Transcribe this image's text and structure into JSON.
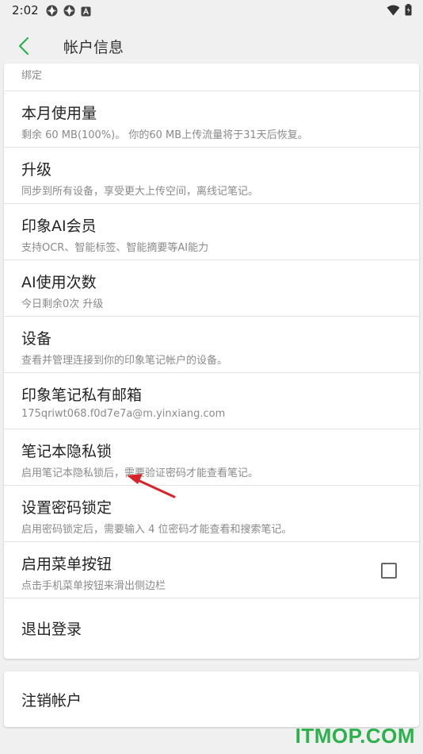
{
  "status_bar": {
    "time": "2:02"
  },
  "app_bar": {
    "title": "帐户信息",
    "back_icon": "chevron-left-icon"
  },
  "partial_row": {
    "subtitle": "绑定"
  },
  "rows": [
    {
      "title": "本月使用量",
      "subtitle": "剩余 60 MB(100%)。 你的60 MB上传流量将于31天后恢复。"
    },
    {
      "title": "升级",
      "subtitle": "同步到所有设备，享受更大上传空间，离线记笔记。"
    },
    {
      "title": "印象AI会员",
      "subtitle": "支持OCR、智能标签、智能摘要等AI能力"
    },
    {
      "title": "AI使用次数",
      "subtitle": "今日剩余0次 升级"
    },
    {
      "title": "设备",
      "subtitle": "查看并管理连接到你的印象笔记帐户的设备。"
    },
    {
      "title": "印象笔记私有邮箱",
      "subtitle": "175qriwt068.f0d7e7a@m.yinxiang.com"
    },
    {
      "title": "笔记本隐私锁",
      "subtitle": "启用笔记本隐私锁后，需要验证密码才能查看笔记。"
    },
    {
      "title": "设置密码锁定",
      "subtitle": "启用密码锁定后，需要输入 4 位密码才能查看和搜索笔记。"
    },
    {
      "title": "启用菜单按钮",
      "subtitle": "点击手机菜单按钮来滑出侧边栏",
      "checkbox": false
    },
    {
      "title": "退出登录"
    }
  ],
  "cancel_account": {
    "title": "注销帐户"
  },
  "watermark": "ITMOP.COM",
  "colors": {
    "accent": "#2bb24c",
    "arrow": "#d9232a"
  }
}
